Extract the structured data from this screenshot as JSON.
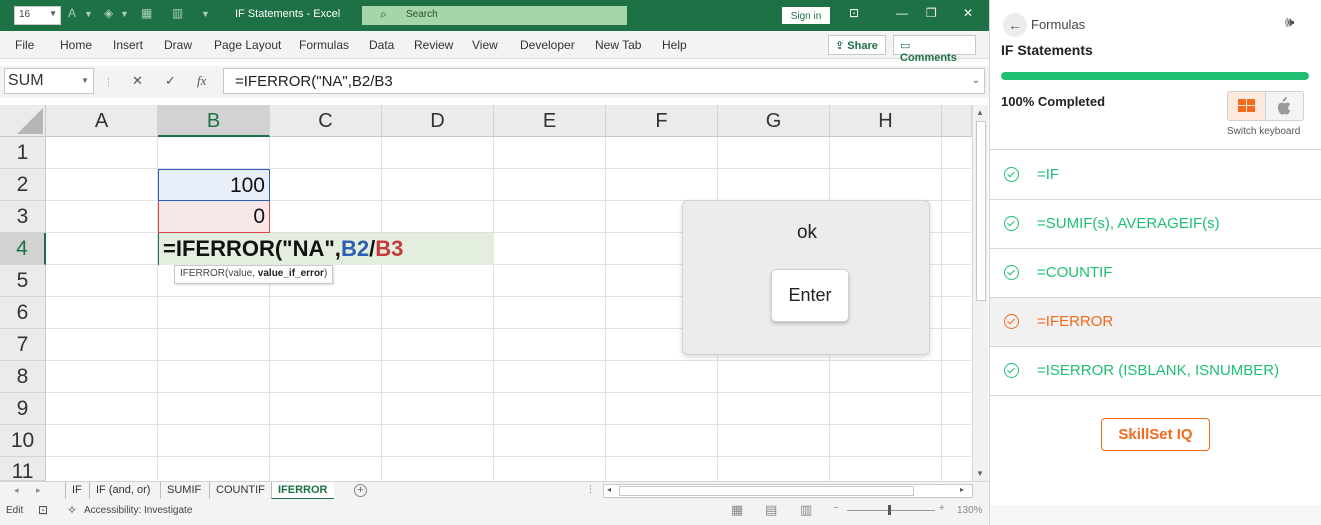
{
  "titlebar": {
    "font_size": "16",
    "doc_title": "IF Statements  -  Excel",
    "search_placeholder": "Search",
    "signin": "Sign in"
  },
  "menu": [
    "File",
    "Home",
    "Insert",
    "Draw",
    "Page Layout",
    "Formulas",
    "Data",
    "Review",
    "View",
    "Developer",
    "New Tab",
    "Help"
  ],
  "share_label": "Share",
  "comments_label": "Comments",
  "formula_bar": {
    "name_box": "SUM",
    "formula": "=IFERROR(\"NA\",B2/B3"
  },
  "columns": [
    "A",
    "B",
    "C",
    "D",
    "E",
    "F",
    "G",
    "H"
  ],
  "rows": [
    "1",
    "2",
    "3",
    "4",
    "5",
    "6",
    "7",
    "8",
    "9",
    "10",
    "11"
  ],
  "cells": {
    "b2": "100",
    "b3": "0",
    "b4_func": "=IFERROR(\"NA\",",
    "b4_ref1": "B2",
    "b4_slash": "/",
    "b4_ref2": "B3"
  },
  "tooltip": {
    "prefix": "IFERROR(value, ",
    "bold": "value_if_error",
    "suffix": ")"
  },
  "sheets": [
    "IF",
    "IF (and, or)",
    "SUMIF",
    "COUNTIF",
    "IFERROR"
  ],
  "active_sheet": "IFERROR",
  "status": {
    "mode": "Edit",
    "accessibility": "Accessibility: Investigate",
    "zoom": "130%"
  },
  "popup": {
    "message": "ok",
    "button": "Enter"
  },
  "panel": {
    "breadcrumb": "Formulas",
    "title": "IF Statements",
    "progress": 1.0,
    "completed_text": "100% Completed",
    "switch_keyboard": "Switch keyboard",
    "lessons": [
      {
        "label": "=IF",
        "state": "complete"
      },
      {
        "label": "=SUMIF(s), AVERAGEIF(s)",
        "state": "complete"
      },
      {
        "label": "=COUNTIF",
        "state": "complete"
      },
      {
        "label": "=IFERROR",
        "state": "active"
      },
      {
        "label": "=ISERROR (ISBLANK, ISNUMBER)",
        "state": "complete"
      }
    ],
    "skillset_button": "SkillSet IQ"
  },
  "colors": {
    "excel_green": "#1e7145",
    "accent_green": "#1fbf73",
    "accent_orange": "#f26a1b"
  }
}
